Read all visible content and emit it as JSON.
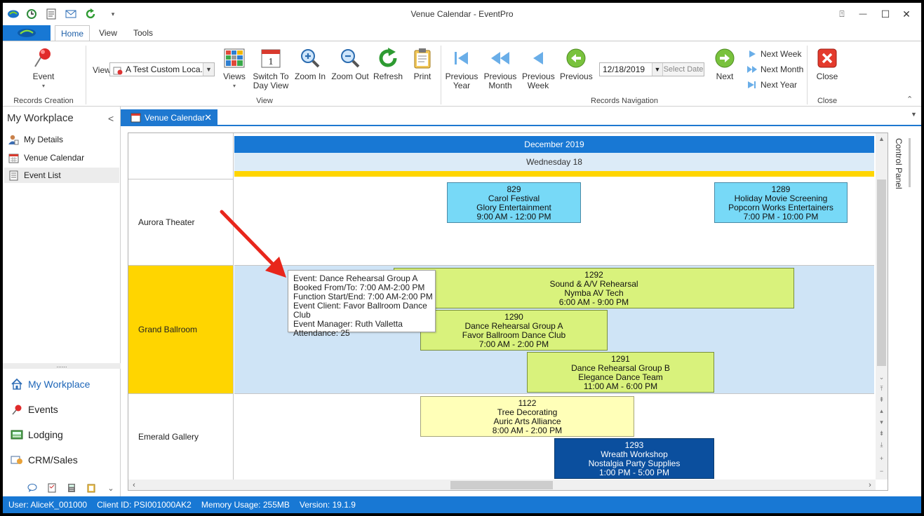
{
  "window": {
    "title": "Venue Calendar - EventPro",
    "controls": {
      "help": "⍐",
      "minimize": "—",
      "maximize": "☐",
      "close": "✕"
    }
  },
  "quick_access": [
    "app-icon",
    "clock-icon",
    "document-icon",
    "mail-icon",
    "refresh-icon",
    "customize-icon"
  ],
  "ribbon": {
    "tabs": [
      "Home",
      "View",
      "Tools"
    ],
    "active_tab": "Home",
    "view_label": "View",
    "view_combo_value": "A Test Custom Loca...",
    "buttons": {
      "event": "Event",
      "views": "Views",
      "switch_to_day_view": "Switch To Day View",
      "zoom_in": "Zoom In",
      "zoom_out": "Zoom Out",
      "refresh": "Refresh",
      "print": "Print",
      "previous_year": "Previous Year",
      "previous_month": "Previous Month",
      "previous_week": "Previous Week",
      "previous": "Previous",
      "next": "Next",
      "next_week": "Next Week",
      "next_month": "Next Month",
      "next_year": "Next Year",
      "close": "Close"
    },
    "date_value": "12/18/2019",
    "select_date": "Select Date",
    "groups": {
      "records_creation": "Records Creation",
      "view": "View",
      "records_navigation": "Records Navigation",
      "close": "Close"
    }
  },
  "workplace": {
    "title": "My Workplace",
    "collapse": "<",
    "items": [
      "My Details",
      "Venue Calendar",
      "Event List"
    ],
    "selected_item": "Event List",
    "splitter": "......",
    "nav": [
      "My Workplace",
      "Events",
      "Lodging",
      "CRM/Sales"
    ],
    "selected_nav": "My Workplace"
  },
  "doc_tab": {
    "label": "Venue Calendar",
    "close": "✕"
  },
  "calendar": {
    "month": "December 2019",
    "day": "Wednesday 18",
    "rooms": [
      "Aurora Theater",
      "Grand Ballroom",
      "Emerald Gallery"
    ],
    "events": [
      {
        "id": "829",
        "name": "Carol Festival",
        "client": "Glory Entertainment",
        "time": "9:00 AM - 12:00 PM"
      },
      {
        "id": "1289",
        "name": "Holiday Movie Screening",
        "client": "Popcorn Works Entertainers",
        "time": "7:00 PM - 10:00 PM"
      },
      {
        "id": "1292",
        "name": "Sound & A/V Rehearsal",
        "client": "Nymba AV Tech",
        "time": "6:00 AM - 9:00 PM"
      },
      {
        "id": "1290",
        "name": "Dance Rehearsal Group A",
        "client": "Favor Ballroom Dance Club",
        "time": "7:00 AM - 2:00 PM"
      },
      {
        "id": "1291",
        "name": "Dance Rehearsal Group B",
        "client": "Elegance Dance Team",
        "time": "11:00 AM - 6:00 PM"
      },
      {
        "id": "1122",
        "name": "Tree Decorating",
        "client": "Auric Arts Alliance",
        "time": "8:00 AM - 2:00 PM"
      },
      {
        "id": "1293",
        "name": "Wreath Workshop",
        "client": "Nostalgia Party Supplies",
        "time": "1:00 PM - 5:00 PM"
      }
    ],
    "tooltip": [
      "Event: Dance Rehearsal Group A",
      "Booked From/To: 7:00 AM-2:00 PM",
      "Function Start/End: 7:00 AM-2:00 PM",
      "Event Client: Favor Ballroom Dance Club",
      "Event Manager: Ruth Valletta",
      "Attendance: 25"
    ],
    "colors": {
      "header": "#1878d4",
      "today": "#ffd500",
      "selected_room": "#ffd500",
      "selected_row": "#cfe4f6"
    }
  },
  "control_panel": "Control Panel",
  "status": {
    "user": "User: AliceK_001000",
    "client_id": "Client ID: PSI001000AK2",
    "memory": "Memory Usage: 255MB",
    "version": "Version: 19.1.9"
  }
}
